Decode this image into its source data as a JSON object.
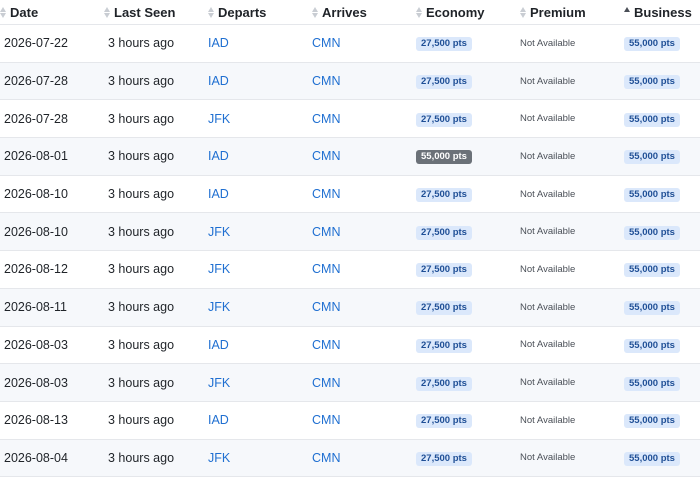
{
  "headers": [
    "Date",
    "Last Seen",
    "Departs",
    "Arrives",
    "Economy",
    "Premium",
    "Business"
  ],
  "sorted_column": "Business",
  "colors": {
    "link": "#1f6fd1",
    "pill_bg": "#dbe8fb",
    "pill_text": "#1f4f96",
    "pill_highlight_bg": "#6b7178",
    "row_stripe": "#f6f8fb"
  },
  "rows": [
    {
      "date": "2026-07-22",
      "seen": "3 hours ago",
      "departs": "IAD",
      "arrives": "CMN",
      "economy": "27,500 pts",
      "premium": "Not Available",
      "business": "55,000 pts"
    },
    {
      "date": "2026-07-28",
      "seen": "3 hours ago",
      "departs": "IAD",
      "arrives": "CMN",
      "economy": "27,500 pts",
      "premium": "Not Available",
      "business": "55,000 pts"
    },
    {
      "date": "2026-07-28",
      "seen": "3 hours ago",
      "departs": "JFK",
      "arrives": "CMN",
      "economy": "27,500 pts",
      "premium": "Not Available",
      "business": "55,000 pts"
    },
    {
      "date": "2026-08-01",
      "seen": "3 hours ago",
      "departs": "IAD",
      "arrives": "CMN",
      "economy": "55,000 pts",
      "economy_highlight": true,
      "premium": "Not Available",
      "business": "55,000 pts"
    },
    {
      "date": "2026-08-10",
      "seen": "3 hours ago",
      "departs": "IAD",
      "arrives": "CMN",
      "economy": "27,500 pts",
      "premium": "Not Available",
      "business": "55,000 pts"
    },
    {
      "date": "2026-08-10",
      "seen": "3 hours ago",
      "departs": "JFK",
      "arrives": "CMN",
      "economy": "27,500 pts",
      "premium": "Not Available",
      "business": "55,000 pts"
    },
    {
      "date": "2026-08-12",
      "seen": "3 hours ago",
      "departs": "JFK",
      "arrives": "CMN",
      "economy": "27,500 pts",
      "premium": "Not Available",
      "business": "55,000 pts"
    },
    {
      "date": "2026-08-11",
      "seen": "3 hours ago",
      "departs": "JFK",
      "arrives": "CMN",
      "economy": "27,500 pts",
      "premium": "Not Available",
      "business": "55,000 pts"
    },
    {
      "date": "2026-08-03",
      "seen": "3 hours ago",
      "departs": "IAD",
      "arrives": "CMN",
      "economy": "27,500 pts",
      "premium": "Not Available",
      "business": "55,000 pts"
    },
    {
      "date": "2026-08-03",
      "seen": "3 hours ago",
      "departs": "JFK",
      "arrives": "CMN",
      "economy": "27,500 pts",
      "premium": "Not Available",
      "business": "55,000 pts"
    },
    {
      "date": "2026-08-13",
      "seen": "3 hours ago",
      "departs": "IAD",
      "arrives": "CMN",
      "economy": "27,500 pts",
      "premium": "Not Available",
      "business": "55,000 pts"
    },
    {
      "date": "2026-08-04",
      "seen": "3 hours ago",
      "departs": "JFK",
      "arrives": "CMN",
      "economy": "27,500 pts",
      "premium": "Not Available",
      "business": "55,000 pts"
    }
  ]
}
